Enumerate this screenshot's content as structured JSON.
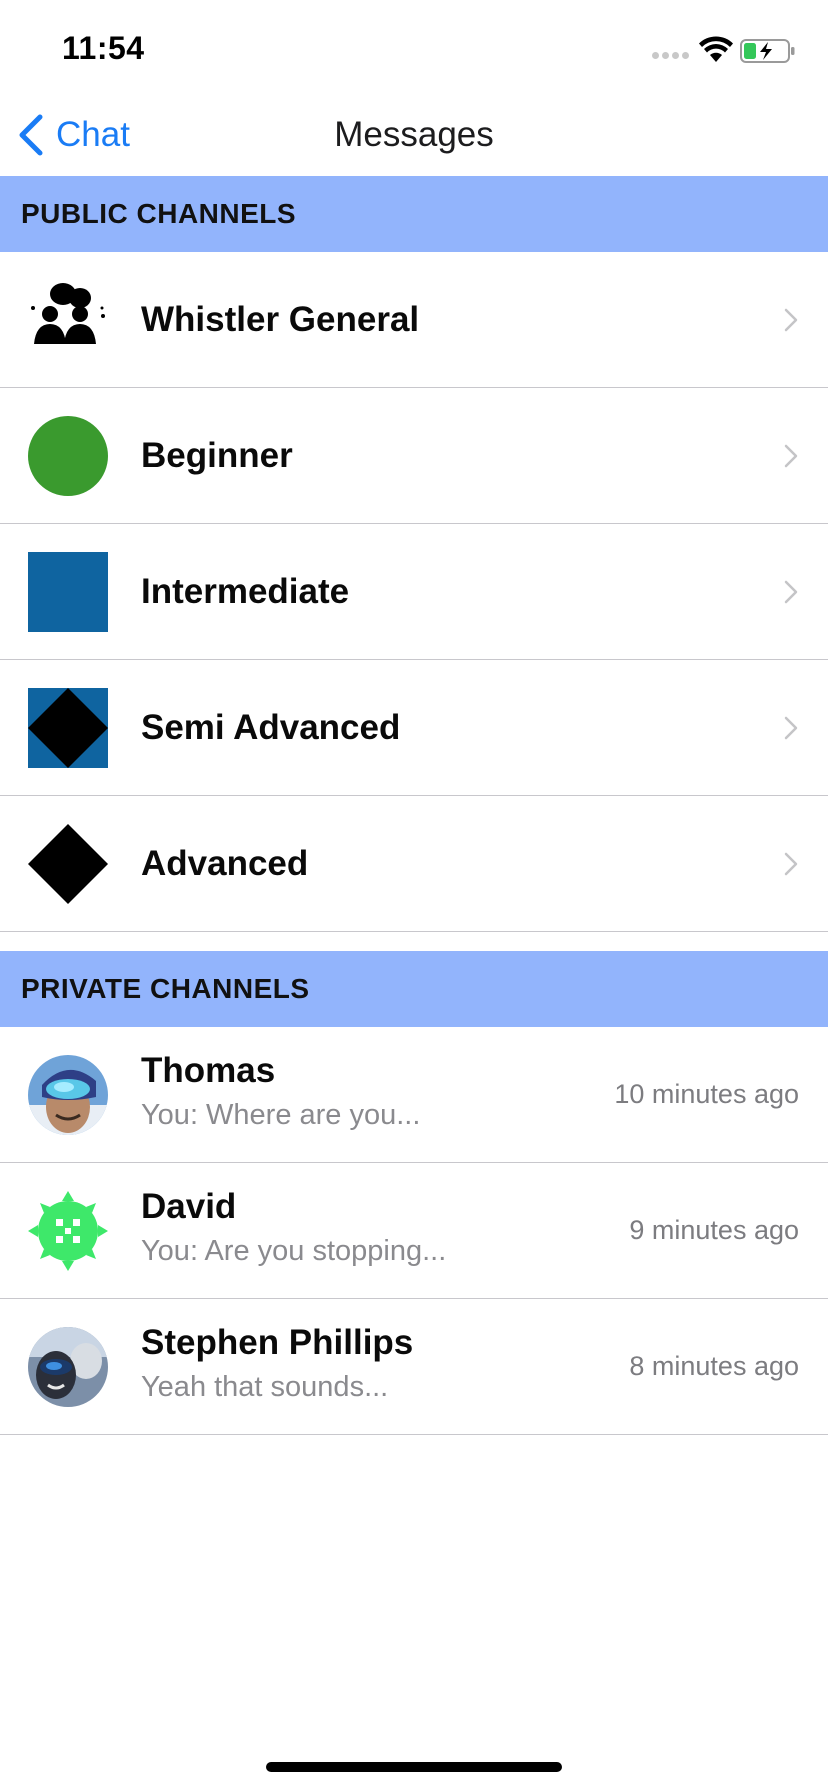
{
  "status_bar": {
    "time": "11:54"
  },
  "nav": {
    "back_label": "Chat",
    "title": "Messages"
  },
  "public_section": {
    "header": "PUBLIC CHANNELS",
    "channels": [
      {
        "title": "Whistler General",
        "icon": "people-chat-icon"
      },
      {
        "title": "Beginner",
        "icon": "green-circle-icon"
      },
      {
        "title": "Intermediate",
        "icon": "blue-square-icon"
      },
      {
        "title": "Semi Advanced",
        "icon": "black-diamond-on-blue-icon"
      },
      {
        "title": "Advanced",
        "icon": "black-diamond-icon"
      }
    ]
  },
  "private_section": {
    "header": "PRIVATE CHANNELS",
    "chats": [
      {
        "name": "Thomas",
        "preview": "You: Where are you...",
        "time": "10 minutes ago",
        "avatar": "avatar-thomas"
      },
      {
        "name": "David",
        "preview": "You: Are you stopping...",
        "time": "9 minutes ago",
        "avatar": "avatar-david"
      },
      {
        "name": "Stephen Phillips",
        "preview": "Yeah that sounds...",
        "time": "8 minutes ago",
        "avatar": "avatar-stephen"
      }
    ]
  },
  "colors": {
    "accent": "#1a7cf5",
    "section_header_bg": "#92b4fc",
    "beginner_green": "#3a9a2e",
    "intermediate_blue": "#0f64a0"
  }
}
